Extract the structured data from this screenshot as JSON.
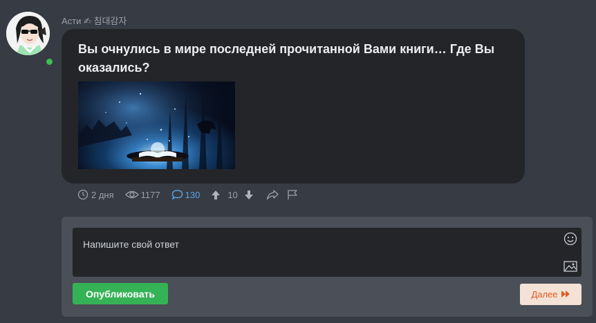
{
  "author": {
    "name": "Асти ✍ 침대감자",
    "online": true
  },
  "post": {
    "question": "Вы очнулись в мире последней прочитанной Вами книги… Где Вы оказались?"
  },
  "stats": {
    "time": "2 дня",
    "views": "1177",
    "comments": "130",
    "rating": "10"
  },
  "reply": {
    "placeholder": "Напишите свой ответ",
    "publish_label": "Опубликовать",
    "next_label": "Далее"
  },
  "colors": {
    "background": "#373b44",
    "bubble": "#232529",
    "publish": "#36b256",
    "next_bg": "#f5e2d6",
    "next_text": "#e05a1f",
    "comments_accent": "#5aa7e6",
    "online": "#3fbf4f"
  }
}
